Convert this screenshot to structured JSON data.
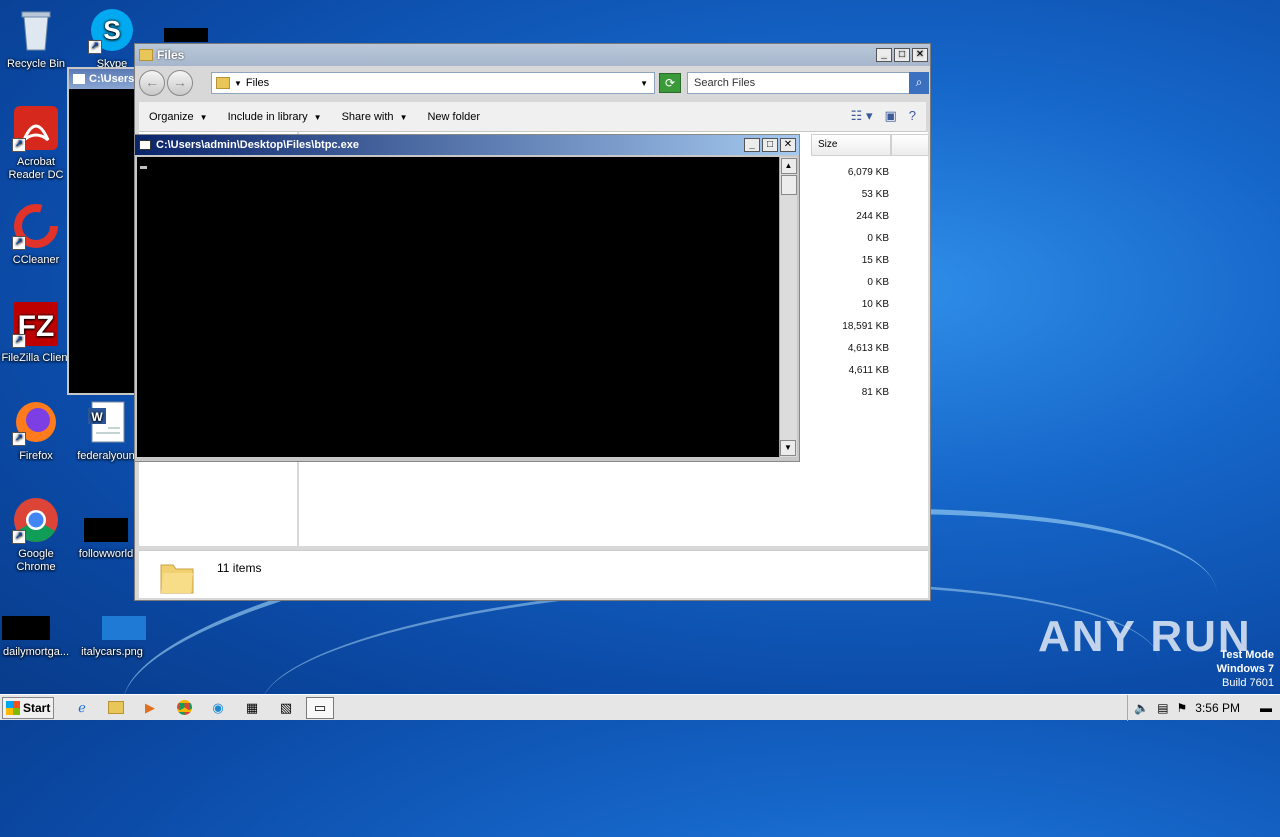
{
  "desktop": {
    "icons": [
      {
        "label": "Recycle Bin"
      },
      {
        "label": "Skype"
      },
      {
        "label": "Acrobat Reader DC"
      },
      {
        "label": "CCleaner"
      },
      {
        "label": "FileZilla Client"
      },
      {
        "label": "Firefox"
      },
      {
        "label": "federalyoun"
      },
      {
        "label": "Google Chrome"
      },
      {
        "label": "followworld"
      },
      {
        "label": "dailymortga..."
      },
      {
        "label": "italycars.png"
      }
    ]
  },
  "explorer": {
    "title": "Files",
    "address": "Files",
    "search_placeholder": "Search Files",
    "toolbar": {
      "organize": "Organize",
      "include_in_library": "Include in library",
      "share_with": "Share with",
      "new_folder": "New folder"
    },
    "column_size": "Size",
    "sizes": [
      "6,079 KB",
      "53 KB",
      "244 KB",
      "0 KB",
      "15 KB",
      "0 KB",
      "10 KB",
      "18,591 KB",
      "4,613 KB",
      "4,611 KB",
      "81 KB"
    ],
    "status": "11 items"
  },
  "console_bg": {
    "title": "C:\\Users"
  },
  "console": {
    "title": "C:\\Users\\admin\\Desktop\\Files\\btpc.exe"
  },
  "taskbar": {
    "start_label": "Start",
    "clock": "3:56 PM"
  },
  "watermark": "ANY RUN",
  "testmode": {
    "line1": "Test Mode",
    "line2": "Windows 7",
    "line3": "Build 7601"
  }
}
